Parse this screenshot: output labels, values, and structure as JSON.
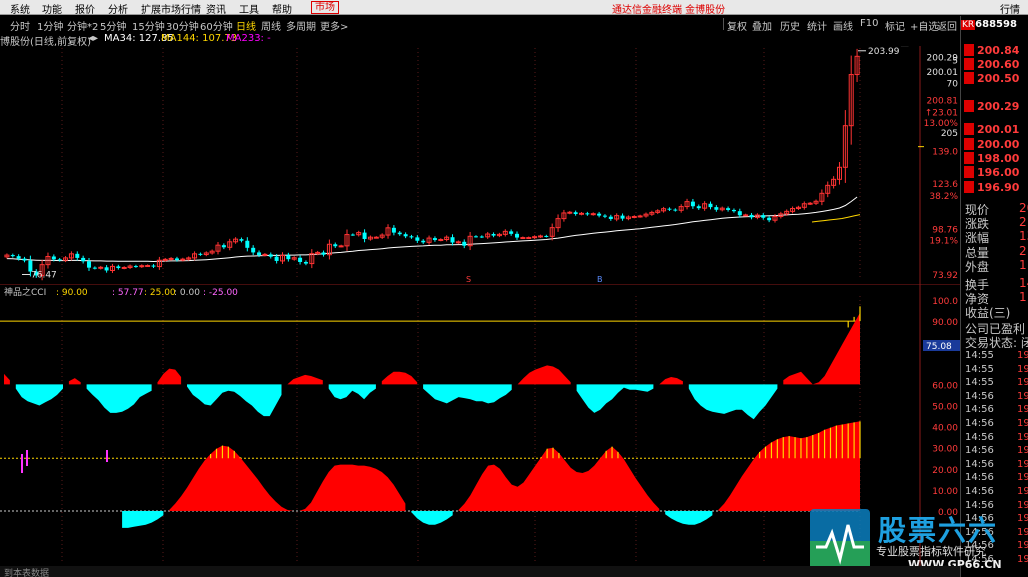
{
  "menu": {
    "items": [
      "系统",
      "功能",
      "报价",
      "分析",
      "扩展市场行情",
      "资讯",
      "工具",
      "帮助"
    ],
    "market": "市场",
    "brand": "通达信金融终端 金博股份",
    "right": "行情"
  },
  "toolbar": {
    "periods": [
      "分时",
      "1分钟",
      "分钟*2",
      "5分钟",
      "15分钟",
      "30分钟",
      "60分钟",
      "日线",
      "周线",
      "多周期",
      "更多>"
    ],
    "active": "日线",
    "actions": [
      "复权",
      "叠加",
      "历史",
      "统计",
      "画线",
      "F10",
      "标记",
      "+自选",
      "返回"
    ]
  },
  "main_chart": {
    "title": "博股份(日线,前复权)",
    "ma34_label": "MA34: 127.85",
    "ma144_label": "MA144: 107.73",
    "ma233_label": "MA233: -",
    "colors": {
      "up": "#ff3333",
      "down": "#00ffff",
      "ma34": "#ffffff",
      "ma144": "#ffd700"
    }
  },
  "sub_chart": {
    "title": "神品之CCI",
    "v1": ": 90.00",
    "v2": ": 57.77",
    "v3": ": 25.00",
    "v4": ": 0.00",
    "v5": ": -25.00",
    "badge": "75.08"
  },
  "quote": {
    "kr": "KR",
    "code": "688598",
    "asks": [
      "200.84",
      "200.60",
      "200.50",
      "200.29"
    ],
    "bids": [
      "200.01",
      "200.00",
      "198.00",
      "196.00",
      "196.90"
    ],
    "rows": [
      {
        "label": "现价",
        "value": "20"
      },
      {
        "label": "涨跌",
        "value": "2"
      },
      {
        "label": "涨幅",
        "value": "13"
      },
      {
        "label": "总量",
        "value": "2"
      },
      {
        "label": "外盘",
        "value": "1"
      },
      {
        "label": "换手",
        "value": "14"
      },
      {
        "label": "净资",
        "value": "1"
      },
      {
        "label": "收益(三)",
        "value": ""
      }
    ],
    "profit": "公司已盈利",
    "status": "交易状态: 闭",
    "ticks": [
      {
        "t": "14:55",
        "v": "19"
      },
      {
        "t": "14:55",
        "v": "19"
      },
      {
        "t": "14:55",
        "v": "19"
      },
      {
        "t": "14:56",
        "v": "19"
      },
      {
        "t": "14:56",
        "v": "19"
      },
      {
        "t": "14:56",
        "v": "19"
      },
      {
        "t": "14:56",
        "v": "19"
      },
      {
        "t": "14:56",
        "v": "19"
      },
      {
        "t": "14:56",
        "v": "19"
      },
      {
        "t": "14:56",
        "v": "19"
      },
      {
        "t": "14:56",
        "v": "19"
      },
      {
        "t": "14:56",
        "v": "19"
      },
      {
        "t": "14:56",
        "v": "19"
      },
      {
        "t": "14:56",
        "v": "19"
      },
      {
        "t": "14:56",
        "v": "19"
      },
      {
        "t": "14:56",
        "v": "19"
      }
    ]
  },
  "watermark": {
    "title": "股票六六",
    "sub": "专业股票指标软件研究",
    "url": "WWW.GP66.CN"
  },
  "bottom": "到本表数据",
  "chart_data": [
    {
      "type": "candlestick",
      "title": "博股份(日线,前复权)",
      "y_ticks": [
        200.29,
        200.01,
        200.81,
        139.0,
        123.6,
        98.76,
        73.92
      ],
      "y_tick_labels": [
        "200.29",
        "200.01",
        "200.81",
        "139.0",
        "123.6",
        "98.76",
        "73.92"
      ],
      "y_pct_labels": [
        "↑23.01",
        "13.00%",
        "38.2%",
        "19.1%"
      ],
      "annotations": [
        {
          "label": "203.99",
          "value": 203.99,
          "kind": "high"
        },
        {
          "label": "76.47",
          "value": 76.47,
          "kind": "low"
        },
        {
          "label": "5",
          "value": null,
          "kind": "axis-mark"
        },
        {
          "label": "70",
          "value": null,
          "kind": "axis-mark"
        },
        {
          "label": "205",
          "value": null,
          "kind": "axis-mark"
        }
      ],
      "closes": [
        88.0,
        87.4,
        86.0,
        84.9,
        78.7,
        76.5,
        82.6,
        87.2,
        85.6,
        85.1,
        86.4,
        88.7,
        86.4,
        84.5,
        80.9,
        80.6,
        81.1,
        79.3,
        81.6,
        80.7,
        81.0,
        81.8,
        81.5,
        82.0,
        82.1,
        81.5,
        85.1,
        85.6,
        86.1,
        85.2,
        85.7,
        86.4,
        88.7,
        88.3,
        89.2,
        90.2,
        93.6,
        92.4,
        95.5,
        97.0,
        96.1,
        92.1,
        89.5,
        88.0,
        88.4,
        87.1,
        84.7,
        87.9,
        85.7,
        86.5,
        84.1,
        83.2,
        88.8,
        89.5,
        88.2,
        94.1,
        93.0,
        93.2,
        99.6,
        99.5,
        100.7,
        97.1,
        98.1,
        98.1,
        99.3,
        103.4,
        100.7,
        99.8,
        98.6,
        98.0,
        96.1,
        95.2,
        97.6,
        96.5,
        96.8,
        98.1,
        95.1,
        95.5,
        93.3,
        98.6,
        98.5,
        98.3,
        99.9,
        99.0,
        99.7,
        101.4,
        100.0,
        97.9,
        97.9,
        97.9,
        98.4,
        98.8,
        98.6,
        103.5,
        108.6,
        111.8,
        112.2,
        111.2,
        111.6,
        111.0,
        111.4,
        110.3,
        109.7,
        108.4,
        110.3,
        108.6,
        109.5,
        109.8,
        110.1,
        111.1,
        112.1,
        113.0,
        114.2,
        113.7,
        113.3,
        115.4,
        118.2,
        115.6,
        114.5,
        117.0,
        115.1,
        113.6,
        114.5,
        113.5,
        112.8,
        110.5,
        110.7,
        109.3,
        110.6,
        109.1,
        107.7,
        109.8,
        111.3,
        112.7,
        114.3,
        115.0,
        117.0,
        117.3,
        118.4,
        122.9,
        127.4,
        130.8,
        137.6,
        161.1,
        190.0,
        200.3
      ],
      "ma34": [
        86.0,
        85.9,
        85.7,
        85.5,
        85.3,
        85.1,
        85.0,
        85.0,
        85.0,
        84.9,
        84.9,
        85.0,
        85.0,
        84.9,
        84.8,
        84.7,
        84.7,
        84.6,
        84.6,
        84.5,
        84.5,
        84.5,
        84.5,
        84.5,
        84.5,
        84.4,
        84.5,
        84.6,
        84.7,
        84.7,
        84.8,
        84.9,
        85.1,
        85.2,
        85.4,
        85.6,
        85.9,
        86.2,
        86.5,
        86.9,
        87.2,
        87.4,
        87.5,
        87.6,
        87.7,
        87.8,
        87.8,
        87.9,
        88.0,
        88.0,
        88.1,
        88.1,
        88.3,
        88.5,
        88.7,
        89.0,
        89.3,
        89.5,
        89.9,
        90.2,
        90.6,
        90.8,
        91.1,
        91.3,
        91.6,
        92.0,
        92.3,
        92.5,
        92.7,
        92.9,
        93.1,
        93.2,
        93.4,
        93.5,
        93.6,
        93.8,
        93.8,
        93.9,
        93.9,
        94.1,
        94.3,
        94.5,
        94.7,
        94.9,
        95.1,
        95.4,
        95.6,
        95.8,
        96.0,
        96.2,
        96.4,
        96.6,
        96.8,
        97.2,
        97.6,
        98.1,
        98.6,
        99.1,
        99.5,
        99.9,
        100.3,
        100.7,
        101.0,
        101.3,
        101.7,
        102.0,
        102.3,
        102.6,
        102.9,
        103.3,
        103.7,
        104.1,
        104.5,
        104.9,
        105.3,
        105.8,
        106.3,
        106.8,
        107.2,
        107.6,
        108.0,
        108.4,
        108.8,
        109.1,
        109.3,
        109.5,
        109.7,
        109.8,
        110.0,
        110.1,
        110.2,
        110.3,
        110.5,
        110.7,
        110.9,
        111.1,
        111.4,
        111.7,
        112.1,
        112.6,
        113.2,
        113.8,
        114.6,
        116.0,
        118.3,
        120.8
      ],
      "ma144_tail": [
        62.0,
        62.6,
        63.3,
        64.0,
        64.8,
        65.5,
        66.2,
        66.9,
        67.6
      ],
      "ylim": [
        73.92,
        205.0
      ]
    },
    {
      "type": "area",
      "title": "神品之CCI",
      "levels": [
        100.0,
        90.0,
        75.08,
        60.0,
        50.0,
        40.0,
        30.0,
        20.0,
        10.0,
        0.0
      ],
      "level_labels": [
        "100.0",
        "90.00",
        "75.08",
        "60.00",
        "50.00",
        "40.00",
        "30.00",
        "20.00",
        "10.00",
        "0.00"
      ],
      "upper_series": [
        65.0,
        62.0,
        58.0,
        54.0,
        52.0,
        51.0,
        50.0,
        51.5,
        53.0,
        55.0,
        58.0,
        61.5,
        63.0,
        61.0,
        58.0,
        55.0,
        52.5,
        49.0,
        46.5,
        46.5,
        47.0,
        48.5,
        50.5,
        54.0,
        55.5,
        57.0,
        61.0,
        65.0,
        67.5,
        67.0,
        63.5,
        59.0,
        55.0,
        53.0,
        50.5,
        50.0,
        53.0,
        56.0,
        57.0,
        56.5,
        54.5,
        52.0,
        50.0,
        47.0,
        45.0,
        45.0,
        50.0,
        55.0,
        60.0,
        62.5,
        63.5,
        64.5,
        64.0,
        63.0,
        62.0,
        58.0,
        54.0,
        53.0,
        54.0,
        57.0,
        55.5,
        53.0,
        56.0,
        58.0,
        61.5,
        64.0,
        66.0,
        66.0,
        65.5,
        64.0,
        61.0,
        58.0,
        55.5,
        53.0,
        52.0,
        51.0,
        52.5,
        54.0,
        53.5,
        53.0,
        52.0,
        52.0,
        51.0,
        51.5,
        53.5,
        55.0,
        57.5,
        60.0,
        63.0,
        65.5,
        67.0,
        68.0,
        69.0,
        68.5,
        67.0,
        64.0,
        61.0,
        57.0,
        53.0,
        49.0,
        46.5,
        48.0,
        51.0,
        53.0,
        56.0,
        58.5,
        57.5,
        57.5,
        57.0,
        56.5,
        58.0,
        60.0,
        62.5,
        63.5,
        63.0,
        61.5,
        58.0,
        53.0,
        50.0,
        48.0,
        47.0,
        46.5,
        46.0,
        47.0,
        48.0,
        48.0,
        45.5,
        43.5,
        47.0,
        50.0,
        54.0,
        58.0,
        62.0,
        64.0,
        65.0,
        66.0,
        63.0,
        60.0,
        61.0,
        64.0,
        69.0,
        74.0,
        79.0,
        84.0,
        89.0,
        94.0
      ],
      "lower_series": [
        5.0,
        5.0,
        5.0,
        5.0,
        5.0,
        5.0,
        5.0,
        5.0,
        5.0,
        5.0,
        5.0,
        5.0,
        5.0,
        5.0,
        5.0,
        5.0,
        5.0,
        5.0,
        5.0,
        5.0,
        -8.0,
        -8.0,
        -7.5,
        -7.0,
        -6.5,
        -5.5,
        -4.0,
        -2.0,
        0.5,
        3.5,
        7.0,
        11.0,
        15.5,
        20.0,
        24.0,
        27.0,
        29.5,
        31.0,
        30.5,
        28.5,
        25.5,
        22.0,
        18.5,
        15.0,
        11.0,
        7.5,
        4.5,
        2.0,
        0.5,
        0.0,
        0.0,
        1.0,
        4.0,
        9.0,
        14.0,
        18.5,
        21.5,
        22.0,
        22.0,
        22.0,
        21.5,
        21.5,
        21.0,
        20.0,
        18.5,
        16.0,
        12.5,
        8.0,
        3.5,
        -0.5,
        -3.5,
        -5.5,
        -6.5,
        -6.5,
        -5.5,
        -4.0,
        -2.0,
        0.5,
        3.5,
        7.5,
        12.5,
        17.5,
        21.5,
        22.0,
        20.0,
        16.0,
        12.5,
        11.5,
        13.5,
        17.5,
        21.5,
        25.5,
        29.5,
        30.0,
        27.5,
        24.0,
        20.5,
        18.5,
        18.0,
        19.0,
        21.5,
        25.0,
        28.5,
        30.5,
        28.0,
        24.5,
        20.0,
        15.5,
        11.5,
        7.5,
        4.0,
        1.0,
        -1.5,
        -3.5,
        -5.0,
        -6.0,
        -6.5,
        -6.5,
        -5.5,
        -4.0,
        -2.0,
        0.5,
        3.5,
        7.5,
        12.0,
        16.5,
        20.5,
        24.5,
        28.0,
        30.5,
        32.5,
        34.0,
        35.0,
        35.5,
        35.0,
        34.5,
        35.0,
        36.0,
        37.0,
        38.5,
        39.5,
        40.5,
        41.0,
        41.5,
        42.0,
        42.5
      ]
    }
  ]
}
